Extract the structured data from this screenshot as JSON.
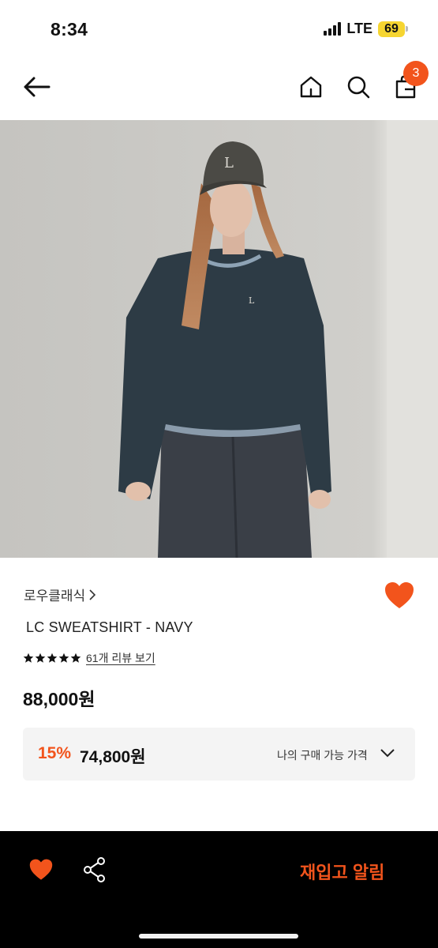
{
  "status_bar": {
    "time": "8:34",
    "network": "LTE",
    "battery": "69"
  },
  "nav": {
    "back_icon": "arrow-left-icon",
    "home_icon": "home-icon",
    "search_icon": "search-icon",
    "cart_icon": "shopping-bag-icon",
    "cart_count": "3"
  },
  "product": {
    "image_alt": "product-photo",
    "brand": "로우클래식",
    "name": "LC SWEATSHIRT - NAVY",
    "rating_stars": 5,
    "review_link": "61개 리뷰 보기",
    "price": "88,000원",
    "discount_rate": "15%",
    "discount_price": "74,800원",
    "my_price_label": "나의 구매 가능 가격",
    "wishlisted": true
  },
  "bottom_bar": {
    "like_icon": "heart-icon",
    "share_icon": "share-icon",
    "restock_label": "재입고 알림"
  },
  "colors": {
    "accent": "#f2541c",
    "price_box_bg": "#f4f4f4",
    "bottom_bar_bg": "#000000"
  }
}
